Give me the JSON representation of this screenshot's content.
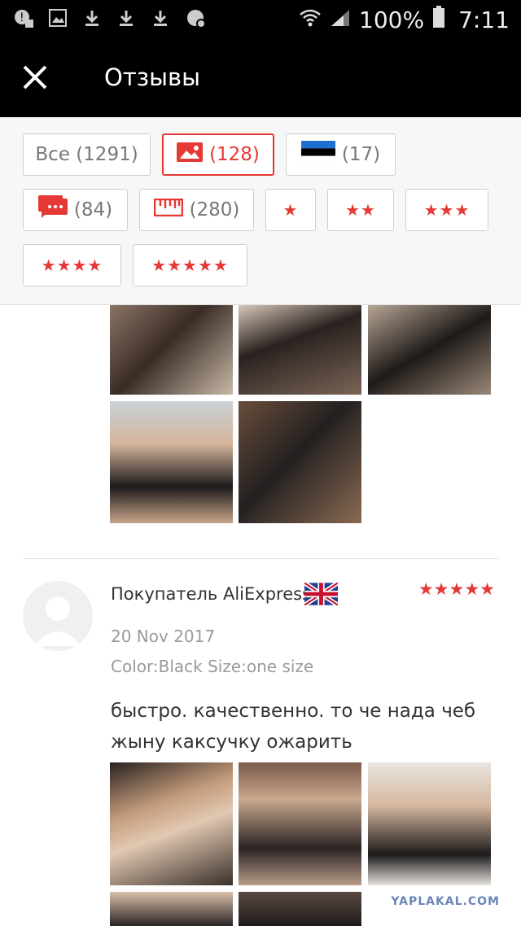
{
  "status_bar": {
    "battery": "100%",
    "time": "7:11",
    "icons": [
      "warning-icon",
      "image-icon",
      "download-icon",
      "download-icon",
      "download-icon",
      "shield-icon",
      "wifi-icon",
      "signal-icon",
      "battery-icon"
    ]
  },
  "app_bar": {
    "title": "Отзывы",
    "close_icon": "close-icon"
  },
  "filters": {
    "all_label": "Все (1291)",
    "photos_count": "(128)",
    "country_count": "(17)",
    "comments_count": "(84)",
    "size_count": "(280)",
    "star_filters": [
      "★",
      "★★",
      "★★★",
      "★★★★",
      "★★★★★"
    ]
  },
  "review": {
    "author": "Покупатель AliExpress",
    "flag": "UK",
    "stars": "★★★★★",
    "rating": 5,
    "date": "20 Nov 2017",
    "properties": "Color:Black Size:one size",
    "text": "быстро. качественно. то че нада чеб жыну каксучку ожарить"
  },
  "watermark": "YAPLAKAL.COM",
  "colors": {
    "accent": "#e53935",
    "bar": "#000000",
    "muted": "#9a9a9a"
  }
}
